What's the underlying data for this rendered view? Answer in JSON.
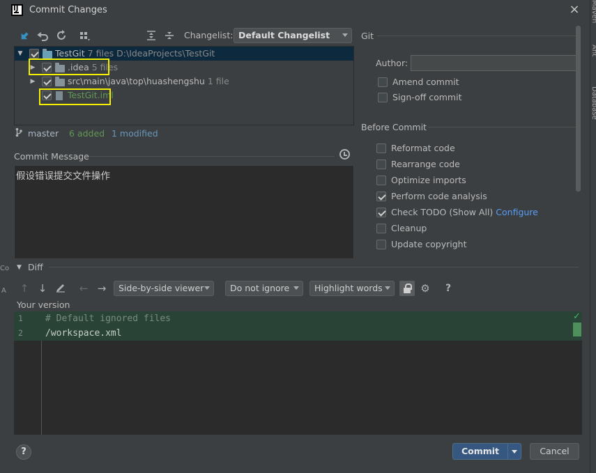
{
  "window": {
    "title": "Commit Changes",
    "close": "×"
  },
  "side_strip": {
    "maven": "Maven",
    "ant": "Ant",
    "database": "Database",
    "left_c": "Co",
    "left_a": "A"
  },
  "toolbar": {
    "changelist_label": "Changelist:",
    "changelist_value": "Default Changelist",
    "icons": [
      "move-to-changelist-icon",
      "rollback-icon",
      "refresh-icon",
      "group-by-icon",
      "expand-all-icon",
      "collapse-all-icon"
    ]
  },
  "tree": {
    "rows": [
      {
        "label": "TestGit",
        "count": "7 files",
        "path": "D:\\IdeaProjects\\TestGit",
        "checked": true,
        "expanded": true
      },
      {
        "label": ".idea",
        "count": "5 files",
        "checked": true,
        "expanded": false
      },
      {
        "label": "src\\main\\java\\top\\huashengshu",
        "count": "1 file",
        "checked": true,
        "expanded": false
      },
      {
        "label": "TestGit.iml",
        "count": "",
        "checked": true
      }
    ]
  },
  "status": {
    "branch": "master",
    "added": "6 added",
    "modified": "1 modified"
  },
  "commit_message": {
    "label": "Commit Message",
    "text": "假设错误提交文件操作"
  },
  "git": {
    "title": "Git",
    "author_label": "Author:",
    "author_value": "",
    "amend": "Amend commit",
    "signoff": "Sign-off commit"
  },
  "before_commit": {
    "title": "Before Commit",
    "options": [
      {
        "label": "Reformat code",
        "checked": false
      },
      {
        "label": "Rearrange code",
        "checked": false
      },
      {
        "label": "Optimize imports",
        "checked": false
      },
      {
        "label": "Perform code analysis",
        "checked": true
      },
      {
        "label": "Check TODO (Show All)",
        "checked": true,
        "link": "Configure"
      },
      {
        "label": "Cleanup",
        "checked": false
      },
      {
        "label": "Update copyright",
        "checked": false
      }
    ]
  },
  "diff": {
    "title": "Diff",
    "viewer": "Side-by-side viewer",
    "ignore": "Do not ignore",
    "highlight": "Highlight words",
    "help": "?",
    "your_version": "Your version",
    "lines": [
      {
        "no": "1",
        "code": "# Default ignored files",
        "kind": "comment"
      },
      {
        "no": "2",
        "code": "/workspace.xml",
        "kind": "text"
      }
    ]
  },
  "footer": {
    "help": "?",
    "commit": "Commit",
    "cancel": "Cancel"
  },
  "colors": {
    "accent": "#365880",
    "added": "#629755",
    "modified": "#6897bb",
    "highlight_box": "#f5f000",
    "diff_added_bg": "#294436"
  }
}
